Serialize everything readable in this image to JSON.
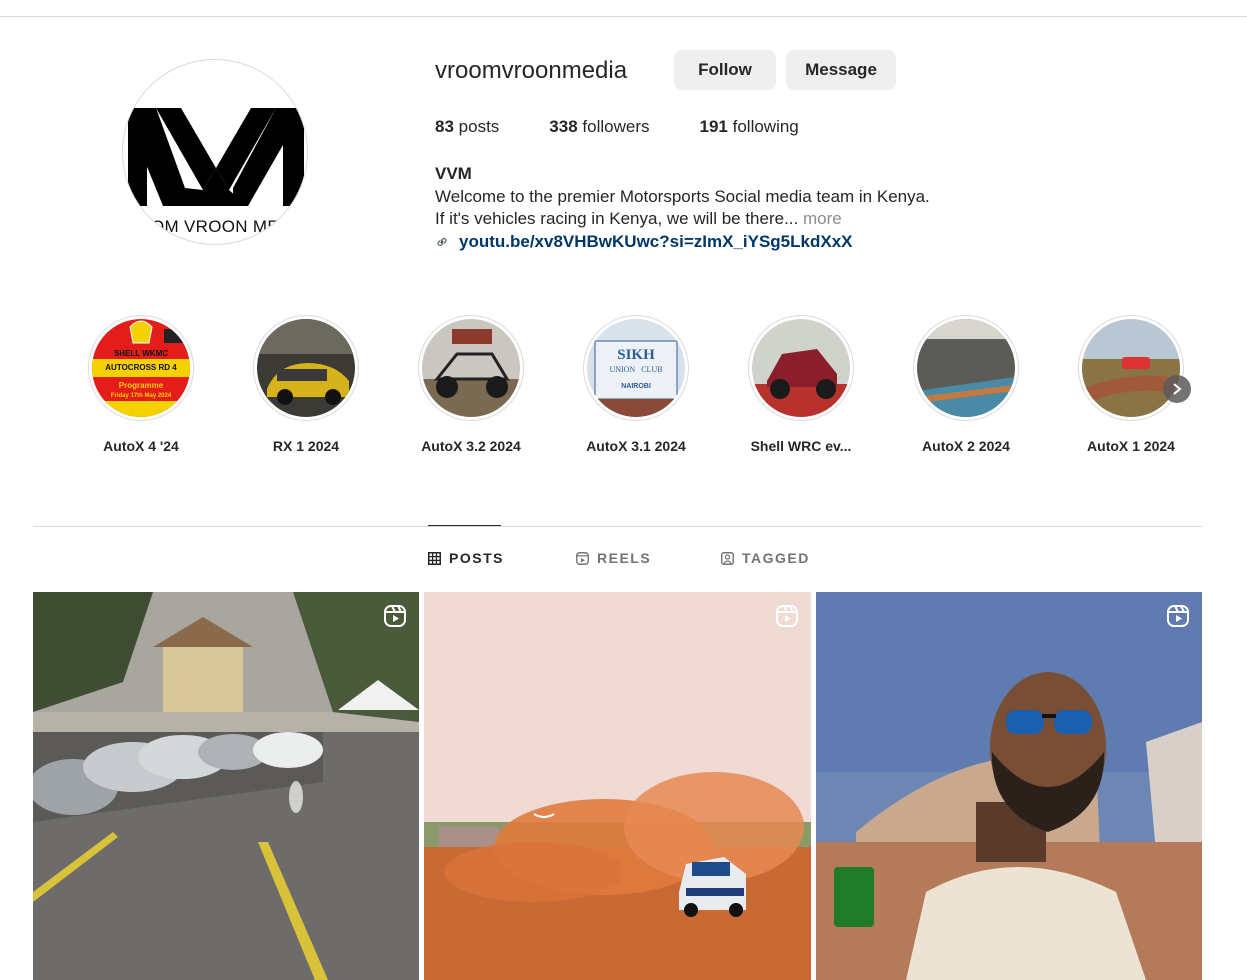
{
  "profile": {
    "username": "vroomvroonmedia",
    "avatar_text": "OM VROON ME",
    "follow_label": "Follow",
    "message_label": "Message",
    "posts_count": "83",
    "posts_label": "posts",
    "followers_count": "338",
    "followers_label": "followers",
    "following_count": "191",
    "following_label": "following",
    "full_name": "VVM",
    "bio_line1": "Welcome to the premier Motorsports Social media team in Kenya.",
    "bio_line2": "If it's vehicles racing in Kenya, we will be there...",
    "more_label": "more",
    "link": "youtu.be/xv8VHBwKUwc?si=zImX_iYSg5LkdXxX"
  },
  "highlights": [
    {
      "label": "AutoX 4 '24",
      "text1": "SHELL WKMC",
      "text2": "AUTOCROSS RD 4",
      "text3": "Programme",
      "text4": "Friday 17th May 2024"
    },
    {
      "label": "RX 1 2024"
    },
    {
      "label": "AutoX 3.2 2024"
    },
    {
      "label": "AutoX 3.1 2024",
      "text1": "SIKH",
      "text2": "UNION",
      "text3": "CLUB",
      "text4": "NAIROBI"
    },
    {
      "label": "Shell WRC ev..."
    },
    {
      "label": "AutoX 2 2024"
    },
    {
      "label": "AutoX 1 2024"
    }
  ],
  "tabs": [
    {
      "label": "POSTS",
      "icon": "grid-icon",
      "active": true
    },
    {
      "label": "REELS",
      "icon": "reels-icon",
      "active": false
    },
    {
      "label": "TAGGED",
      "icon": "tagged-icon",
      "active": false
    }
  ],
  "colors": {
    "button_bg": "#efefef",
    "link": "#00376b",
    "muted": "#8e8e8e",
    "divider": "#dbdbdb"
  }
}
